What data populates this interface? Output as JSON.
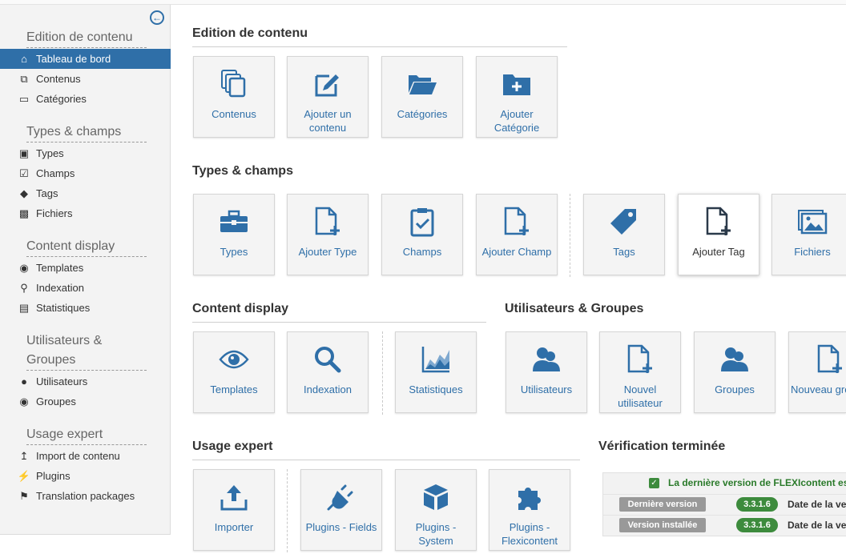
{
  "sidebar": {
    "collapse_icon": "arrow-left-circle-icon",
    "groups": [
      {
        "title": "Edition de contenu",
        "items": [
          {
            "label": "Tableau de bord",
            "icon": "home-icon",
            "active": true
          },
          {
            "label": "Contenus",
            "icon": "copy-icon"
          },
          {
            "label": "Catégories",
            "icon": "folder-open-icon"
          }
        ]
      },
      {
        "title": "Types & champs",
        "items": [
          {
            "label": "Types",
            "icon": "briefcase-icon"
          },
          {
            "label": "Champs",
            "icon": "clipboard-check-icon"
          },
          {
            "label": "Tags",
            "icon": "tags-icon"
          },
          {
            "label": "Fichiers",
            "icon": "image-icon"
          }
        ]
      },
      {
        "title": "Content display",
        "items": [
          {
            "label": "Templates",
            "icon": "eye-icon"
          },
          {
            "label": "Indexation",
            "icon": "search-icon"
          },
          {
            "label": "Statistiques",
            "icon": "chart-area-icon"
          }
        ]
      },
      {
        "title": "Utilisateurs & Groupes",
        "items": [
          {
            "label": "Utilisateurs",
            "icon": "user-icon"
          },
          {
            "label": "Groupes",
            "icon": "users-icon"
          }
        ]
      },
      {
        "title": "Usage expert",
        "items": [
          {
            "label": "Import de contenu",
            "icon": "upload-icon"
          },
          {
            "label": "Plugins",
            "icon": "plug-icon"
          },
          {
            "label": "Translation packages",
            "icon": "flag-icon"
          }
        ]
      }
    ]
  },
  "main": {
    "edition": {
      "title": "Edition de contenu",
      "tiles": [
        {
          "label": "Contenus",
          "icon": "copy-icon"
        },
        {
          "label": "Ajouter un contenu",
          "icon": "edit-icon"
        },
        {
          "label": "Catégories",
          "icon": "folder-open-icon"
        },
        {
          "label": "Ajouter Catégorie",
          "icon": "folder-plus-icon"
        }
      ]
    },
    "types": {
      "title": "Types & champs",
      "tiles": [
        {
          "label": "Types",
          "icon": "briefcase-icon"
        },
        {
          "label": "Ajouter Type",
          "icon": "file-plus-icon"
        },
        {
          "label": "Champs",
          "icon": "clipboard-check-icon"
        },
        {
          "label": "Ajouter Champ",
          "icon": "file-plus-icon"
        },
        {
          "label": "Tags",
          "icon": "tag-icon"
        },
        {
          "label": "Ajouter Tag",
          "icon": "file-plus-icon"
        },
        {
          "label": "Fichiers",
          "icon": "images-icon"
        }
      ]
    },
    "display": {
      "title": "Content display",
      "tiles": [
        {
          "label": "Templates",
          "icon": "eye-icon"
        },
        {
          "label": "Indexation",
          "icon": "search-icon"
        },
        {
          "label": "Statistiques",
          "icon": "chart-area-icon"
        }
      ]
    },
    "users": {
      "title": "Utilisateurs & Groupes",
      "tiles": [
        {
          "label": "Utilisateurs",
          "icon": "user-icon"
        },
        {
          "label": "Nouvel utilisateur",
          "icon": "file-plus-icon"
        },
        {
          "label": "Groupes",
          "icon": "users-icon"
        },
        {
          "label": "Nouveau gro",
          "icon": "file-plus-icon"
        }
      ]
    },
    "expert": {
      "title": "Usage expert",
      "tiles": [
        {
          "label": "Importer",
          "icon": "upload-icon"
        },
        {
          "label": "Plugins - Fields",
          "icon": "plug-icon"
        },
        {
          "label": "Plugins - System",
          "icon": "cube-icon"
        },
        {
          "label": "Plugins - Flexicontent",
          "icon": "puzzle-icon"
        }
      ]
    },
    "verification": {
      "title": "Vérification terminée",
      "message": "La dernière version de FLEXIcontent es",
      "rows": [
        {
          "label": "Dernière version",
          "version": "3.3.1.6",
          "date": "Date de la ve"
        },
        {
          "label": "Version installée",
          "version": "3.3.1.6",
          "date": "Date de la ve"
        }
      ]
    }
  },
  "colors": {
    "accent": "#2f6fa8",
    "success": "#3d8b3d",
    "badge": "#999999"
  }
}
